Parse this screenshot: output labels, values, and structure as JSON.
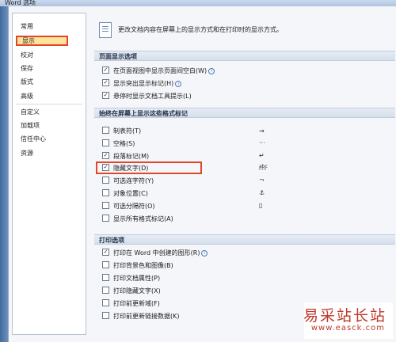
{
  "window": {
    "title": "Word 选项"
  },
  "sidebar": {
    "items": [
      {
        "label": "常用"
      },
      {
        "label": "显示"
      },
      {
        "label": "校对"
      },
      {
        "label": "保存"
      },
      {
        "label": "版式"
      },
      {
        "label": "高级"
      },
      {
        "label": "自定义"
      },
      {
        "label": "加载项"
      },
      {
        "label": "信任中心"
      },
      {
        "label": "资源"
      }
    ],
    "selected": "显示"
  },
  "main": {
    "description": "更改文档内容在屏幕上的显示方式和在打印时的显示方式。",
    "page_display": {
      "header": "页面显示选项",
      "options": [
        {
          "label": "在页面视图中显示页面间空白(W)",
          "checked": true,
          "info": true
        },
        {
          "label": "显示突出显示标记(H)",
          "checked": true,
          "info": true
        },
        {
          "label": "悬停时显示文档工具提示(L)",
          "checked": true,
          "info": false
        }
      ]
    },
    "format_marks": {
      "header": "始终在屏幕上显示这些格式标记",
      "options": [
        {
          "label": "制表符(T)",
          "checked": false,
          "symbol": "→"
        },
        {
          "label": "空格(S)",
          "checked": false,
          "symbol": "···"
        },
        {
          "label": "段落标记(M)",
          "checked": true,
          "symbol": "↵"
        },
        {
          "label": "隐藏文字(D)",
          "checked": true,
          "symbol": "abc"
        },
        {
          "label": "可选连字符(Y)",
          "checked": false,
          "symbol": "¬"
        },
        {
          "label": "对象位置(C)",
          "checked": false,
          "symbol": "⚓"
        },
        {
          "label": "可选分隔符(O)",
          "checked": false,
          "symbol": "▯"
        },
        {
          "label": "显示所有格式标记(A)",
          "checked": false,
          "symbol": ""
        }
      ]
    },
    "print": {
      "header": "打印选项",
      "options": [
        {
          "label": "打印在 Word 中创建的图形(R)",
          "checked": true,
          "info": true
        },
        {
          "label": "打印背景色和图像(B)",
          "checked": false,
          "info": false
        },
        {
          "label": "打印文档属性(P)",
          "checked": false,
          "info": false
        },
        {
          "label": "打印隐藏文字(X)",
          "checked": false,
          "info": false
        },
        {
          "label": "打印前更新域(F)",
          "checked": false,
          "info": false
        },
        {
          "label": "打印前更新链接数据(K)",
          "checked": false,
          "info": false
        }
      ]
    }
  },
  "watermark": {
    "text": "易采站长站",
    "url": "www.easck.com"
  },
  "colors": {
    "highlight_border": "#e0462a",
    "selected_bg": "#fde49a"
  }
}
